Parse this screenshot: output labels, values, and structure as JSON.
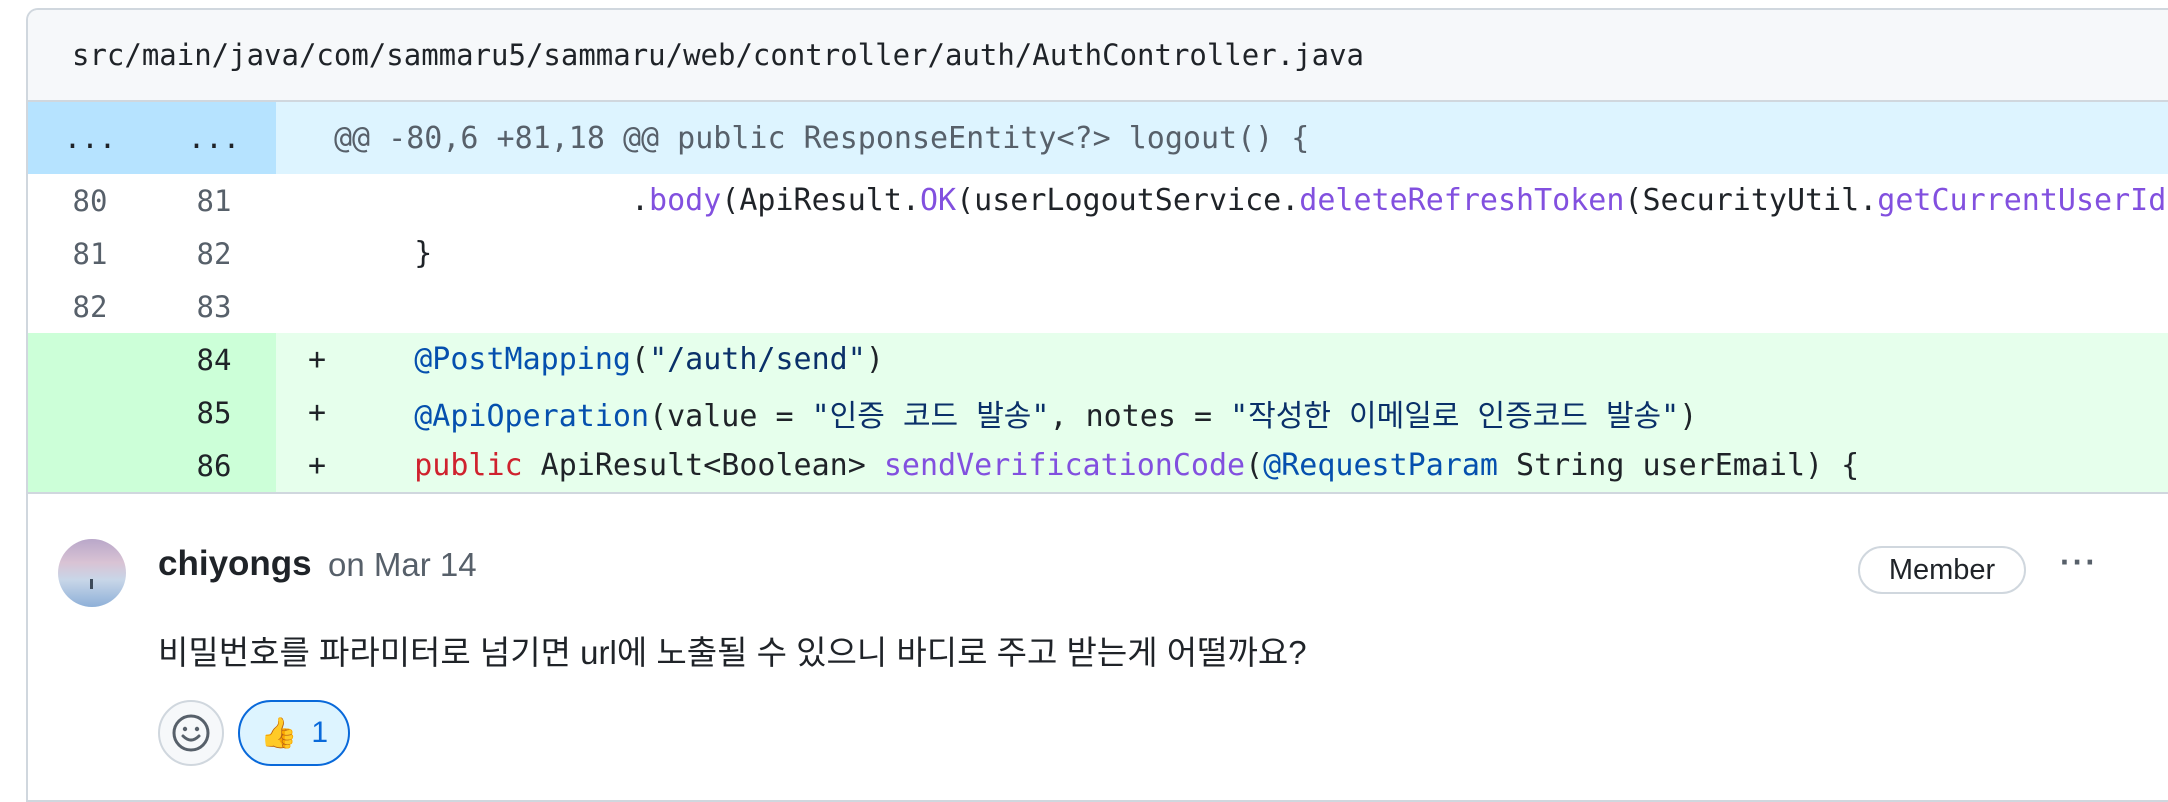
{
  "file": {
    "path": "src/main/java/com/sammaru5/sammaru/web/controller/auth/AuthController.java"
  },
  "hunk": {
    "old_num": "...",
    "new_num": "...",
    "header": "@@ -80,6 +81,18 @@ public ResponseEntity<?> logout() {"
  },
  "lines": [
    {
      "old": "80",
      "new": "81",
      "sign": "",
      "type": "context",
      "tokens": [
        {
          "t": "                .",
          "c": ""
        },
        {
          "t": "body",
          "c": "fn"
        },
        {
          "t": "(ApiResult.",
          "c": ""
        },
        {
          "t": "OK",
          "c": "fn"
        },
        {
          "t": "(userLogoutService.",
          "c": ""
        },
        {
          "t": "deleteRefreshToken",
          "c": "fn"
        },
        {
          "t": "(SecurityUtil.",
          "c": ""
        },
        {
          "t": "getCurrentUserId",
          "c": "fn"
        }
      ]
    },
    {
      "old": "81",
      "new": "82",
      "sign": "",
      "type": "context",
      "tokens": [
        {
          "t": "    }",
          "c": ""
        }
      ]
    },
    {
      "old": "82",
      "new": "83",
      "sign": "",
      "type": "context",
      "tokens": [
        {
          "t": "",
          "c": ""
        }
      ]
    },
    {
      "old": "",
      "new": "84",
      "sign": "+",
      "type": "added",
      "tokens": [
        {
          "t": "    ",
          "c": ""
        },
        {
          "t": "@PostMapping",
          "c": "an"
        },
        {
          "t": "(",
          "c": ""
        },
        {
          "t": "\"/auth/send\"",
          "c": "str"
        },
        {
          "t": ")",
          "c": ""
        }
      ]
    },
    {
      "old": "",
      "new": "85",
      "sign": "+",
      "type": "added",
      "tokens": [
        {
          "t": "    ",
          "c": ""
        },
        {
          "t": "@ApiOperation",
          "c": "an"
        },
        {
          "t": "(value = ",
          "c": ""
        },
        {
          "t": "\"인증 코드 발송\"",
          "c": "str"
        },
        {
          "t": ", notes = ",
          "c": ""
        },
        {
          "t": "\"작성한 이메일로 인증코드 발송\"",
          "c": "str"
        },
        {
          "t": ")",
          "c": ""
        }
      ]
    },
    {
      "old": "",
      "new": "86",
      "sign": "+",
      "type": "added",
      "tokens": [
        {
          "t": "    ",
          "c": ""
        },
        {
          "t": "public",
          "c": "kw"
        },
        {
          "t": " ApiResult<Boolean> ",
          "c": ""
        },
        {
          "t": "sendVerificationCode",
          "c": "fn"
        },
        {
          "t": "(",
          "c": ""
        },
        {
          "t": "@RequestParam",
          "c": "an"
        },
        {
          "t": " String userEmail) {",
          "c": ""
        }
      ]
    }
  ],
  "comment": {
    "author": "chiyongs",
    "date": "on Mar 14",
    "badge": "Member",
    "more": "···",
    "body": "비밀번호를 파라미터로 넘기면 url에 노출될 수 있으니 바디로 주고 받는게 어떨까요?",
    "reaction": {
      "emoji": "👍",
      "count": "1",
      "icon": "thumbs-up-icon"
    },
    "add_reaction_icon": "smiley-icon"
  },
  "colors": {
    "added_bg": "#e6ffec",
    "hunk_bg": "#ddf4ff",
    "accent": "#0969da"
  }
}
